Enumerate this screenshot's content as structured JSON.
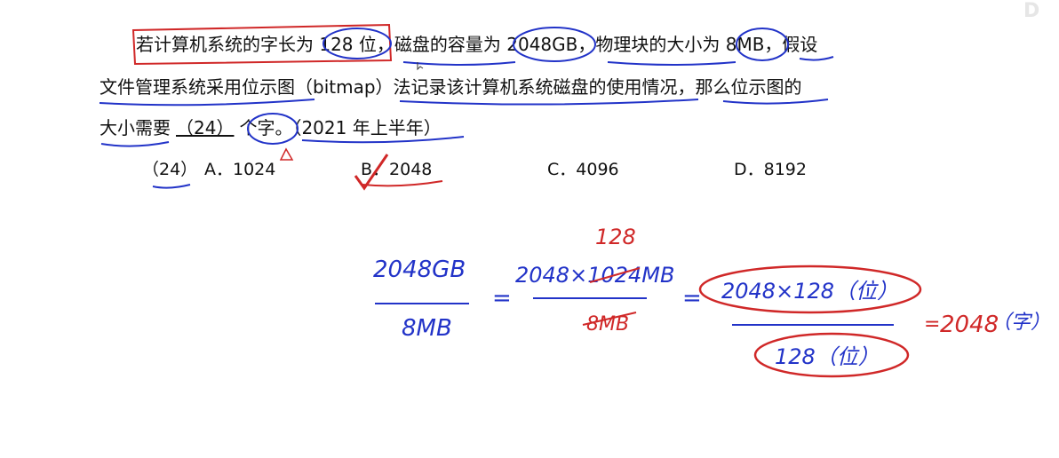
{
  "question": {
    "line1": "若计算机系统的字长为 128 位，磁盘的容量为 2048GB，物理块的大小为 8MB，假设",
    "line2": "文件管理系统采用位示图（bitmap）法记录该计算机系统磁盘的使用情况，那么位示图的",
    "line3_prefix": "大小需要",
    "line3_blank": "（24）",
    "line3_suffix": "个字。（2021 年上半年）"
  },
  "options": {
    "number": "（24）",
    "a": "A．1024",
    "b": "B．2048",
    "c": "C．4096",
    "d": "D．8192"
  },
  "handwriting": {
    "frac1_num": "2048GB",
    "frac1_den": "8MB",
    "eq1": "=",
    "frac2_num": "2048×1024MB",
    "frac2_above": "128",
    "frac2_den": "8MB",
    "eq2": "=",
    "frac3_num": "2048×128（位）",
    "frac3_den": "128（位）",
    "eq3": "=",
    "result_num": "2048",
    "result_unit": "（字）"
  },
  "colors": {
    "blue_ink": "#2233c8",
    "red_ink": "#d02828",
    "text": "#111111"
  }
}
